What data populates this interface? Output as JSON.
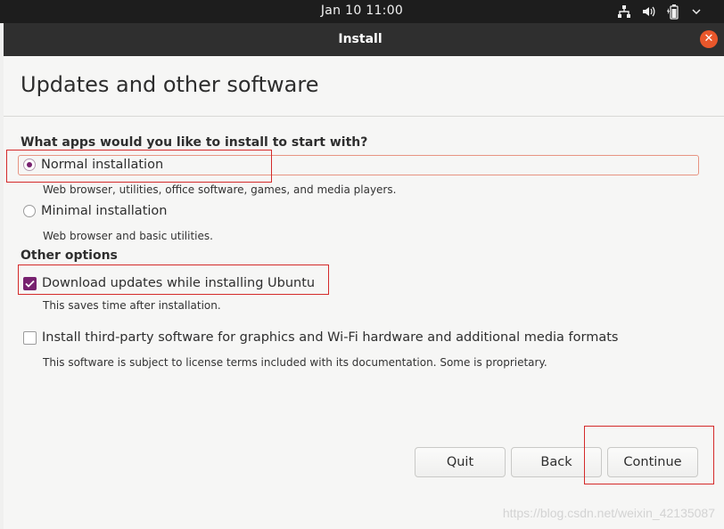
{
  "topbar": {
    "clock": "Jan 10  11:00",
    "icons": [
      "network-icon",
      "volume-icon",
      "battery-icon",
      "power-menu-icon"
    ]
  },
  "window": {
    "title": "Install",
    "close_icon": "close-icon"
  },
  "page": {
    "title": "Updates and other software"
  },
  "apps_section": {
    "heading": "What apps would you like to install to start with?",
    "options": [
      {
        "label": "Normal installation",
        "description": "Web browser, utilities, office software, games, and media players.",
        "selected": true
      },
      {
        "label": "Minimal installation",
        "description": "Web browser and basic utilities.",
        "selected": false
      }
    ]
  },
  "other_section": {
    "heading": "Other options",
    "options": [
      {
        "label": "Download updates while installing Ubuntu",
        "description": "This saves time after installation.",
        "checked": true
      },
      {
        "label": "Install third-party software for graphics and Wi-Fi hardware and additional media formats",
        "description": "This software is subject to license terms included with its documentation. Some is proprietary.",
        "checked": false
      }
    ]
  },
  "buttons": {
    "quit": "Quit",
    "back": "Back",
    "continue": "Continue"
  },
  "watermark": "https://blog.csdn.net/weixin_42135087",
  "colors": {
    "accent": "#77216f",
    "close": "#e9572b",
    "annotation": "#d42a2a"
  }
}
